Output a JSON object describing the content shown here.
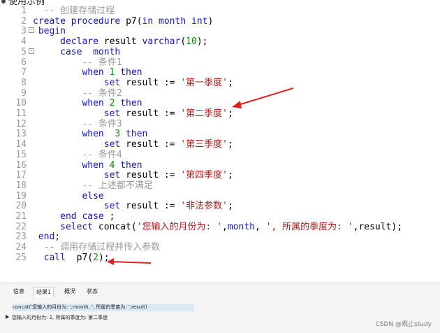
{
  "header": {
    "text": "使用示例"
  },
  "editor": {
    "lines": [
      {
        "n": "1",
        "parts": [
          {
            "t": "  -- 创建存储过程",
            "c": "cm"
          }
        ]
      },
      {
        "n": "2",
        "parts": [
          {
            "t": "create procedure ",
            "c": "kw"
          },
          {
            "t": "p7(",
            "c": ""
          },
          {
            "t": "in month int",
            "c": "kw"
          },
          {
            "t": ")",
            "c": ""
          }
        ]
      },
      {
        "n": "3",
        "fold": "minus",
        "parts": [
          {
            "t": " begin",
            "c": "kw"
          }
        ]
      },
      {
        "n": "4",
        "parts": [
          {
            "t": "     declare ",
            "c": "kw"
          },
          {
            "t": "result ",
            "c": ""
          },
          {
            "t": "varchar",
            "c": "kw"
          },
          {
            "t": "(",
            "c": ""
          },
          {
            "t": "10",
            "c": "num"
          },
          {
            "t": ");",
            "c": ""
          }
        ]
      },
      {
        "n": "5",
        "fold": "minus",
        "parts": [
          {
            "t": "     case  month",
            "c": "kw"
          }
        ]
      },
      {
        "n": "6",
        "parts": [
          {
            "t": "         -- 条件1",
            "c": "cm"
          }
        ]
      },
      {
        "n": "7",
        "parts": [
          {
            "t": "         when ",
            "c": "kw"
          },
          {
            "t": "1",
            "c": "num"
          },
          {
            "t": " then",
            "c": "kw"
          }
        ]
      },
      {
        "n": "8",
        "parts": [
          {
            "t": "             set ",
            "c": "kw"
          },
          {
            "t": "result := ",
            "c": ""
          },
          {
            "t": "'第一季度'",
            "c": "str"
          },
          {
            "t": ";",
            "c": ""
          }
        ]
      },
      {
        "n": "9",
        "parts": [
          {
            "t": "         -- 条件2",
            "c": "cm"
          }
        ]
      },
      {
        "n": "10",
        "parts": [
          {
            "t": "         when ",
            "c": "kw"
          },
          {
            "t": "2",
            "c": "num"
          },
          {
            "t": " then",
            "c": "kw"
          }
        ]
      },
      {
        "n": "11",
        "parts": [
          {
            "t": "             set ",
            "c": "kw"
          },
          {
            "t": "result := ",
            "c": ""
          },
          {
            "t": "'第二季度'",
            "c": "str"
          },
          {
            "t": ";",
            "c": ""
          }
        ]
      },
      {
        "n": "12",
        "parts": [
          {
            "t": "         -- 条件3",
            "c": "cm"
          }
        ]
      },
      {
        "n": "13",
        "parts": [
          {
            "t": "         when  ",
            "c": "kw"
          },
          {
            "t": "3",
            "c": "num"
          },
          {
            "t": " then",
            "c": "kw"
          }
        ]
      },
      {
        "n": "14",
        "parts": [
          {
            "t": "             set ",
            "c": "kw"
          },
          {
            "t": "result := ",
            "c": ""
          },
          {
            "t": "'第三季度'",
            "c": "str"
          },
          {
            "t": ";",
            "c": ""
          }
        ]
      },
      {
        "n": "15",
        "parts": [
          {
            "t": "         -- 条件4",
            "c": "cm"
          }
        ]
      },
      {
        "n": "16",
        "parts": [
          {
            "t": "         when ",
            "c": "kw"
          },
          {
            "t": "4",
            "c": "num"
          },
          {
            "t": " then",
            "c": "kw"
          }
        ]
      },
      {
        "n": "17",
        "parts": [
          {
            "t": "             set ",
            "c": "kw"
          },
          {
            "t": "result := ",
            "c": ""
          },
          {
            "t": "'第四季度'",
            "c": "str"
          },
          {
            "t": ";",
            "c": ""
          }
        ]
      },
      {
        "n": "18",
        "parts": [
          {
            "t": "         -- 上述都不满足",
            "c": "cm"
          }
        ]
      },
      {
        "n": "19",
        "parts": [
          {
            "t": "         else",
            "c": "kw"
          }
        ]
      },
      {
        "n": "20",
        "parts": [
          {
            "t": "             set ",
            "c": "kw"
          },
          {
            "t": "result := ",
            "c": ""
          },
          {
            "t": "'非法参数'",
            "c": "str"
          },
          {
            "t": ";",
            "c": ""
          }
        ]
      },
      {
        "n": "21",
        "parts": [
          {
            "t": "     end case ",
            "c": "kw"
          },
          {
            "t": ";",
            "c": ""
          }
        ]
      },
      {
        "n": "22",
        "parts": [
          {
            "t": "     select ",
            "c": "kw"
          },
          {
            "t": "concat(",
            "c": ""
          },
          {
            "t": "'您输入的月份为: '",
            "c": "str"
          },
          {
            "t": ",",
            "c": ""
          },
          {
            "t": "month",
            "c": "kw"
          },
          {
            "t": ", ",
            "c": ""
          },
          {
            "t": "', 所属的季度为: '",
            "c": "str"
          },
          {
            "t": ",result);",
            "c": ""
          }
        ]
      },
      {
        "n": "23",
        "parts": [
          {
            "t": " end;",
            "c": "kw"
          }
        ]
      },
      {
        "n": "24",
        "parts": [
          {
            "t": "  -- 调用存储过程并传入参数",
            "c": "cm"
          }
        ]
      },
      {
        "n": "25",
        "parts": [
          {
            "t": "  call ",
            "c": "kw"
          },
          {
            "t": " p7(",
            "c": ""
          },
          {
            "t": "2",
            "c": "num"
          },
          {
            "t": ");",
            "c": ""
          }
        ]
      }
    ]
  },
  "bottom": {
    "tabs": [
      {
        "label": "信息",
        "active": false
      },
      {
        "label": "结果1",
        "active": true
      },
      {
        "label": "概况",
        "active": false
      },
      {
        "label": "状态",
        "active": false
      }
    ],
    "query": "concat('您输入的月份为: ',month, ', 所属的季度为: ',result)",
    "result": "您输入的月份为: 2, 所属的季度为: 第二季度"
  },
  "watermark": "CSDN @观止study",
  "colors": {
    "keyword": "#1515c8",
    "comment": "#9a9a9a",
    "number": "#0a8a0a",
    "string": "#b01a1a",
    "arrow": "#e02020"
  }
}
